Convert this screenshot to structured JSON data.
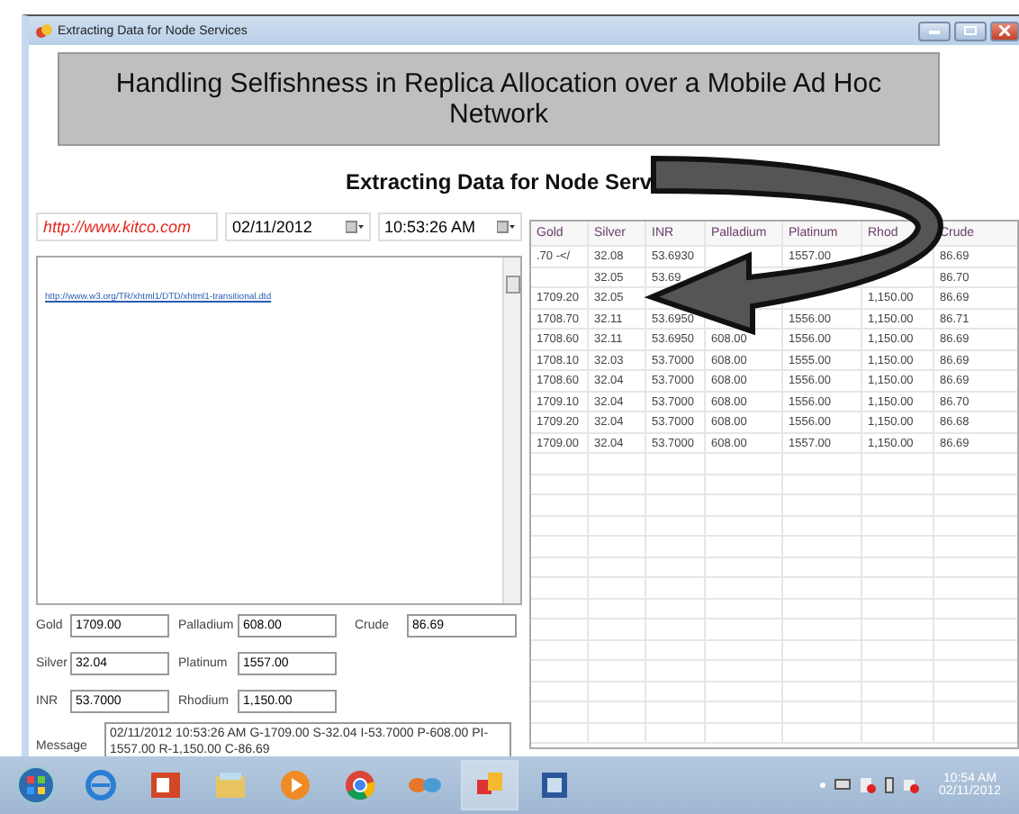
{
  "window": {
    "title": "Extracting Data for Node Services"
  },
  "header": "Handling Selfishness in Replica Allocation over a Mobile Ad Hoc Network",
  "subtitle": "Extracting Data for Node Serv",
  "url_field": {
    "value": "http://www.kitco.com"
  },
  "date_picker": {
    "value": "02/11/2012"
  },
  "time_picker": {
    "value": "10:53:26 AM"
  },
  "browser_box": {
    "link": "http://www.w3.org/TR/xhtml1/DTD/xhtml1-transitional.dtd"
  },
  "fields": [
    {
      "label": "Gold",
      "value": "1709.00"
    },
    {
      "label": "Palladium",
      "value": "608.00"
    },
    {
      "label": "Crude",
      "value": "86.69"
    },
    {
      "label": "Silver",
      "value": "32.04"
    },
    {
      "label": "Platinum",
      "value": "1557.00"
    },
    {
      "label": "INR",
      "value": "53.7000"
    },
    {
      "label": "Rhodium",
      "value": "1,150.00"
    }
  ],
  "message": {
    "label": "Message",
    "value": "02/11/2012 10:53:26 AM G-1709.00 S-32.04 I-53.7000 P-608.00 PI-1557.00 R-1,150.00 C-86.69"
  },
  "table": {
    "columns": [
      "Gold",
      "Silver",
      "INR",
      "Palladium",
      "Platinum",
      "Rhod",
      "Crude"
    ],
    "rows": [
      [
        ".70 -</",
        "32.08",
        "53.6930",
        "",
        "1557.00",
        "",
        "86.69"
      ],
      [
        "",
        "32.05",
        "53.69",
        "",
        "",
        "",
        "86.70"
      ],
      [
        "1709.20",
        "32.05",
        "",
        "",
        "",
        "1,150.00",
        "86.69"
      ],
      [
        "1708.70",
        "32.11",
        "53.6950",
        "",
        "1556.00",
        "1,150.00",
        "86.71"
      ],
      [
        "1708.60",
        "32.11",
        "53.6950",
        "608.00",
        "1556.00",
        "1,150.00",
        "86.69"
      ],
      [
        "1708.10",
        "32.03",
        "53.7000",
        "608.00",
        "1555.00",
        "1,150.00",
        "86.69"
      ],
      [
        "1708.60",
        "32.04",
        "53.7000",
        "608.00",
        "1556.00",
        "1,150.00",
        "86.69"
      ],
      [
        "1709.10",
        "32.04",
        "53.7000",
        "608.00",
        "1556.00",
        "1,150.00",
        "86.70"
      ],
      [
        "1709.20",
        "32.04",
        "53.7000",
        "608.00",
        "1556.00",
        "1,150.00",
        "86.68"
      ],
      [
        "1709.00",
        "32.04",
        "53.7000",
        "608.00",
        "1557.00",
        "1,150.00",
        "86.69"
      ]
    ]
  },
  "taskbar": {
    "clock_time": "10:54 AM",
    "clock_date": "02/11/2012"
  }
}
